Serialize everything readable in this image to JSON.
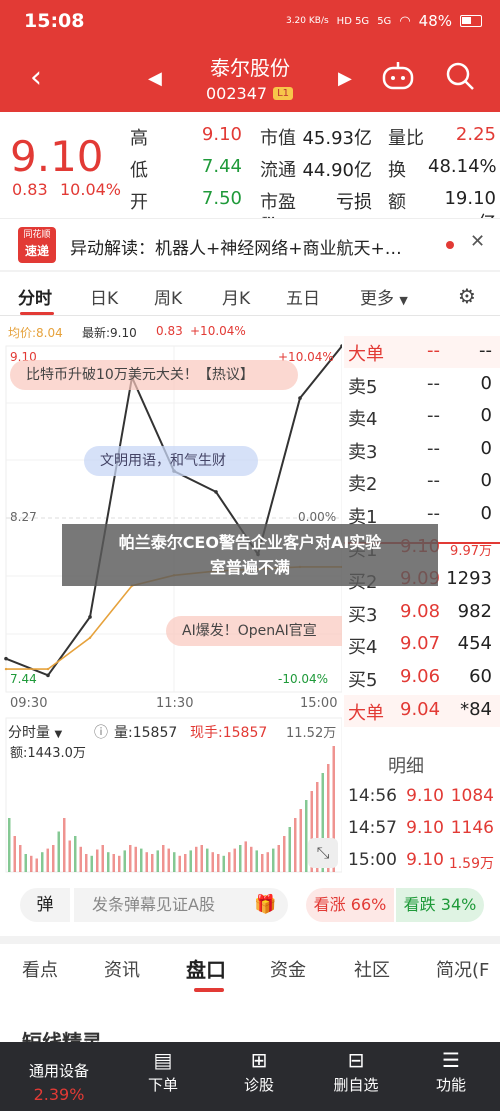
{
  "status": {
    "time": "15:08",
    "net_speed": "3.20 KB/s",
    "signal1": "HD 5G",
    "signal2": "5G",
    "battery": "48%"
  },
  "header": {
    "title": "泰尔股份",
    "code": "002347",
    "level": "L1"
  },
  "quote": {
    "price": "9.10",
    "change": "0.83",
    "change_pct": "10.04%",
    "rows": [
      {
        "l1": "高",
        "v1": "9.10",
        "c1": "#e23a35",
        "l2": "市值",
        "v2": "45.93亿",
        "l3": "量比",
        "v3": "2.25",
        "c3": "#e23a35"
      },
      {
        "l1": "低",
        "v1": "7.44",
        "c1": "#1f9a3a",
        "l2": "流通",
        "v2": "44.90亿",
        "l3": "换",
        "v3": "48.14%",
        "c3": "#222"
      },
      {
        "l1": "开",
        "v1": "7.50",
        "c1": "#1f9a3a",
        "l2": "市盈™",
        "v2": "亏损",
        "l3": "额",
        "v3": "19.10亿",
        "c3": "#222"
      }
    ]
  },
  "news": {
    "logo_top": "同花顺",
    "logo_bottom": "速递",
    "text": "异动解读：机器人+神经网络+商业航天+…"
  },
  "chart_tabs": [
    "分时",
    "日K",
    "周K",
    "月K",
    "五日",
    "更多"
  ],
  "chart": {
    "avg_label": "均价:8.04",
    "latest_label": "最新:9.10",
    "latest_chg": "0.83",
    "latest_pct": "+10.04%",
    "y_top": "9.10",
    "y_mid": "8.27",
    "y_bottom": "7.44",
    "pct_top": "+10.04%",
    "pct_mid": "0.00%",
    "pct_bottom": "-10.04%",
    "times": [
      "09:30",
      "11:30",
      "15:00"
    ],
    "danmaku": [
      "比特币升破10万美元大关！【热议】",
      "文明用语，和气生财",
      "AI爆发！OpenAI官宣"
    ],
    "vol_label": "分时量",
    "vol": "量:15857",
    "now_vol": "现手:15857",
    "vol_max": "11.52万",
    "amount": "额:1443.0万"
  },
  "chart_data": {
    "type": "line",
    "x": [
      "09:30",
      "10:00",
      "10:30",
      "11:00",
      "11:30",
      "13:30",
      "14:00",
      "14:30",
      "15:00"
    ],
    "series": [
      {
        "values": [
          7.6,
          7.52,
          7.8,
          8.95,
          8.5,
          8.4,
          8.1,
          8.85,
          9.1
        ]
      },
      {
        "values": [
          7.55,
          7.55,
          7.7,
          7.95,
          8.0,
          8.02,
          8.03,
          8.04,
          8.04
        ]
      }
    ],
    "ylim": [
      7.44,
      9.1
    ]
  },
  "orderbook": {
    "big_sell": {
      "label": "大单",
      "a": "--",
      "b": "--"
    },
    "asks": [
      {
        "label": "卖5",
        "price": "--",
        "vol": "0"
      },
      {
        "label": "卖4",
        "price": "--",
        "vol": "0"
      },
      {
        "label": "卖3",
        "price": "--",
        "vol": "0"
      },
      {
        "label": "卖2",
        "price": "--",
        "vol": "0"
      },
      {
        "label": "卖1",
        "price": "--",
        "vol": "0"
      }
    ],
    "bids": [
      {
        "label": "买1",
        "price": "9.10",
        "vol": "9.97万"
      },
      {
        "label": "买2",
        "price": "9.09",
        "vol": "1293"
      },
      {
        "label": "买3",
        "price": "9.08",
        "vol": "982"
      },
      {
        "label": "买4",
        "price": "9.07",
        "vol": "454"
      },
      {
        "label": "买5",
        "price": "9.06",
        "vol": "60"
      }
    ],
    "big_buy": {
      "label": "大单",
      "price": "9.04",
      "vol": "*84"
    },
    "detail_title": "明细",
    "details": [
      {
        "time": "14:56",
        "price": "9.10",
        "vol": "1084"
      },
      {
        "time": "14:57",
        "price": "9.10",
        "vol": "1146"
      },
      {
        "time": "15:00",
        "price": "9.10",
        "vol": "1.59万"
      }
    ]
  },
  "overlay": {
    "line1": "帕兰泰尔CEO警告企业客户对AI实验",
    "line2": "室普遍不满"
  },
  "danmaku_bar": {
    "btn": "弹",
    "placeholder": "发条弹幕见证A股",
    "up": "看涨 66%",
    "down": "看跌 34%"
  },
  "bottom_tabs": [
    "看点",
    "资讯",
    "盘口",
    "资金",
    "社区",
    "简况(F"
  ],
  "section_peek": "短线精灵",
  "bottom_nav": {
    "sector": "通用设备",
    "sector_pct": "2.39%",
    "items": [
      "下单",
      "诊股",
      "删自选",
      "功能"
    ]
  },
  "colors": {
    "red": "#e23a35",
    "green": "#1f9a3a",
    "avg": "#e6a23c"
  }
}
